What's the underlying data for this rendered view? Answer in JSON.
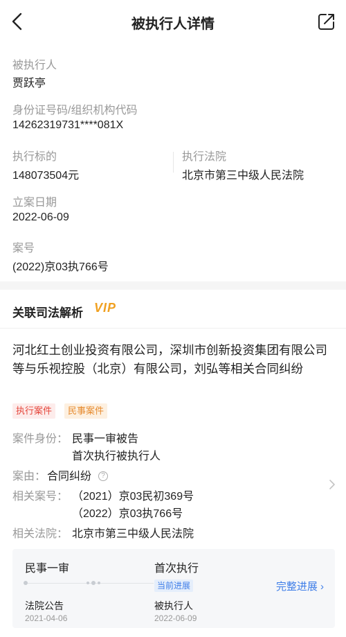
{
  "header": {
    "title": "被执行人详情"
  },
  "basic_info": {
    "person_label": "被执行人",
    "person_name": "贾跃亭",
    "id_label": "身份证号码/组织机构代码",
    "id_value": "14262319731****081X",
    "amount_label": "执行标的",
    "amount_value": "148073504元",
    "court_label": "执行法院",
    "court_value": "北京市第三中级人民法院",
    "date_label": "立案日期",
    "date_value": "2022-06-09",
    "case_no_label": "案号",
    "case_no_value": "(2022)京03执766号"
  },
  "judicial_analysis": {
    "section_title": "关联司法解析",
    "vip_badge": "VIP",
    "case_title": "河北红土创业投资有限公司，深圳市创新投资集团有限公司等与乐视控股（北京）有限公司，刘弘等相关合同纠纷",
    "tags": [
      "执行案件",
      "民事案件"
    ],
    "identity_label": "案件身份：",
    "identity_values": [
      "民事一审被告",
      "首次执行被执行人"
    ],
    "cause_label": "案由：",
    "cause_value": "合同纠纷",
    "related_cases_label": "相关案号：",
    "related_cases": [
      "（2021）京03民初369号",
      "（2022）京03执766号"
    ],
    "related_court_label": "相关法院：",
    "related_court_value": "北京市第三中级人民法院"
  },
  "progress": {
    "stage1": "民事一审",
    "stage2": "首次执行",
    "current_badge": "当前进展",
    "full_link": "完整进展 ›",
    "event1": "法院公告",
    "date1": "2021-04-06",
    "event2": "被执行人",
    "date2": "2022-06-09"
  }
}
